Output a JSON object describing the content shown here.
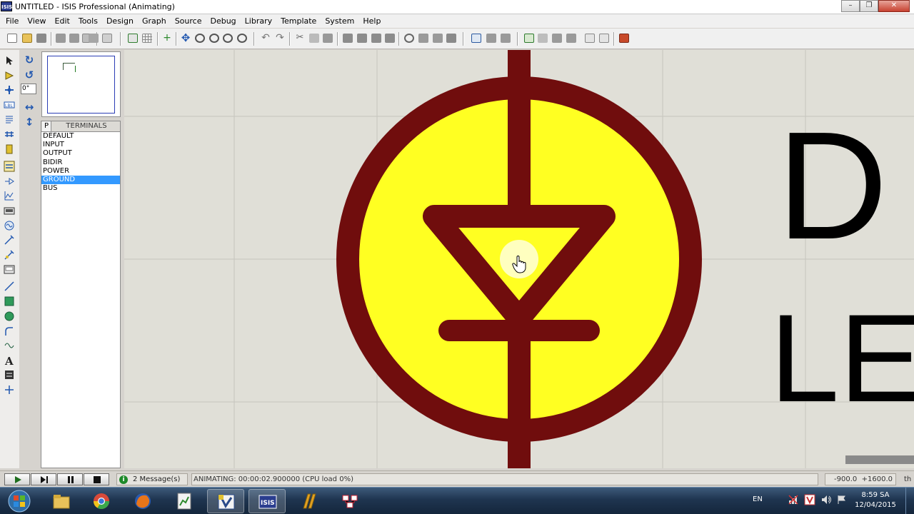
{
  "window": {
    "app_icon_text": "ISIS",
    "title": "UNTITLED - ISIS Professional (Animating)",
    "controls": [
      "minimize",
      "maximize",
      "close"
    ]
  },
  "menu": [
    "File",
    "View",
    "Edit",
    "Tools",
    "Design",
    "Graph",
    "Source",
    "Debug",
    "Library",
    "Template",
    "System",
    "Help"
  ],
  "rotation": {
    "value": "0°"
  },
  "device_panel": {
    "mode_button": "P",
    "title": "TERMINALS",
    "items": [
      "DEFAULT",
      "INPUT",
      "OUTPUT",
      "BIDIR",
      "POWER",
      "GROUND",
      "BUS"
    ],
    "selected": "GROUND"
  },
  "canvas": {
    "component": "LED",
    "label_partial_1": "D",
    "label_partial_2": "LE",
    "colors": {
      "background": "#e0dfd7",
      "grid": "#c4c2bc",
      "outline": "#700d0d",
      "fill": "#ffff22",
      "label": "#000000"
    }
  },
  "status": {
    "messages": "2 Message(s)",
    "animation": "ANIMATING: 00:00:02.900000 (CPU load 0%)",
    "coord_x": "-900.0",
    "coord_y": "+1600.0",
    "units": "th"
  },
  "playback": [
    "play",
    "step",
    "pause",
    "stop"
  ],
  "taskbar": {
    "apps": [
      "windows-explorer",
      "chrome",
      "firefox",
      "app-green",
      "app-vb",
      "isis",
      "app-proteus",
      "app-paint"
    ],
    "active_app": "isis",
    "language": "EN",
    "time": "8:59 SA",
    "date": "12/04/2015"
  }
}
